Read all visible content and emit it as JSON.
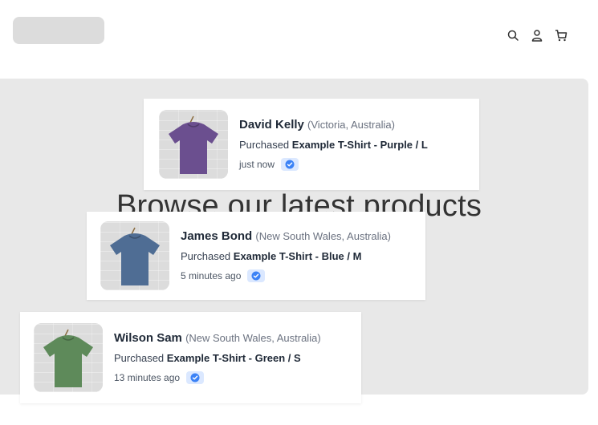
{
  "header": {
    "icons": [
      "search-icon",
      "user-icon",
      "cart-icon"
    ]
  },
  "hero": {
    "title": "Browse our latest products"
  },
  "notifications": [
    {
      "name": "David Kelly",
      "location": "(Victoria, Australia)",
      "purchased_label": "Purchased",
      "product": "Example T-Shirt - Purple / L",
      "time": "just now",
      "shirt_color": "#6b4f8f"
    },
    {
      "name": "James Bond",
      "location": "(New South Wales, Australia)",
      "purchased_label": "Purchased",
      "product": "Example T-Shirt - Blue / M",
      "time": "5 minutes ago",
      "shirt_color": "#4f6d94"
    },
    {
      "name": "Wilson Sam",
      "location": "(New South Wales, Australia)",
      "purchased_label": "Purchased",
      "product": "Example T-Shirt - Green / S",
      "time": "13 minutes ago",
      "shirt_color": "#5e8a5a"
    }
  ],
  "colors": {
    "hero_bg": "#e8e8e8",
    "verified_bg": "#dbe8ff",
    "verified_icon": "#3b82f6"
  }
}
